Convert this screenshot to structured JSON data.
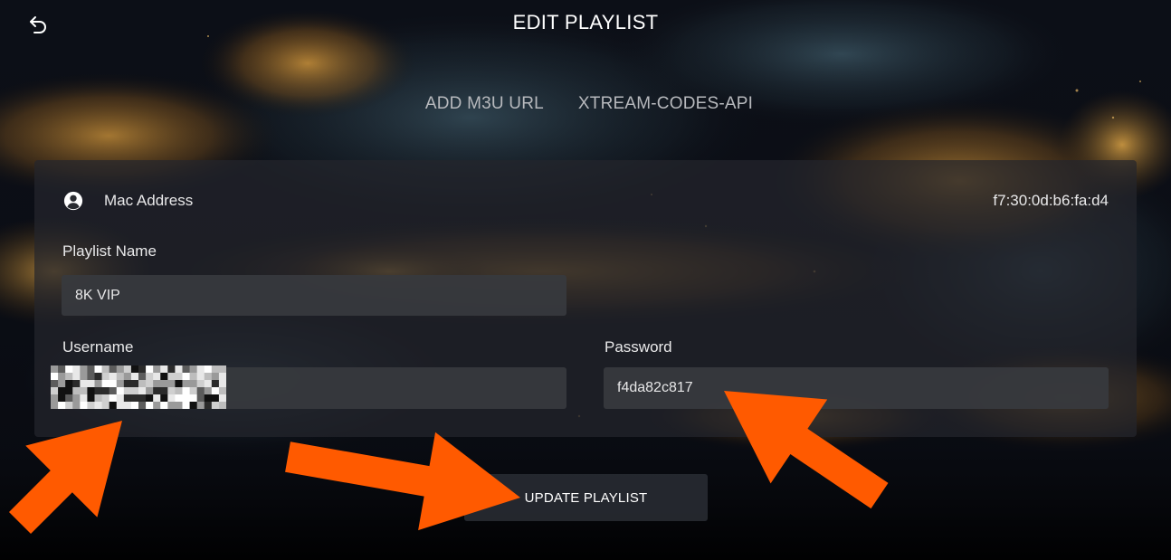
{
  "header": {
    "title": "EDIT PLAYLIST",
    "back_icon": "back-arrow-icon"
  },
  "tabs": [
    {
      "label": "ADD M3U URL"
    },
    {
      "label": "XTREAM-CODES-API"
    }
  ],
  "mac": {
    "label": "Mac Address",
    "value": "f7:30:0d:b6:fa:d4",
    "icon": "user-circle-icon"
  },
  "form": {
    "playlist_name_label": "Playlist Name",
    "playlist_name_value": "8K VIP",
    "username_label": "Username",
    "username_value": "",
    "password_label": "Password",
    "password_value": "f4da82c817"
  },
  "actions": {
    "update_label": "UPDATE PLAYLIST"
  },
  "colors": {
    "arrow": "#ff5a00",
    "panel": "#24262c",
    "field": "#37393e"
  }
}
